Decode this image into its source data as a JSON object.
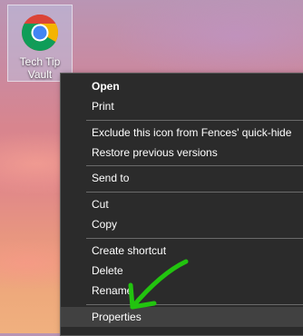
{
  "desktop_icon": {
    "label": "Tech Tip Vault",
    "icon": "chrome-logo-icon"
  },
  "context_menu": {
    "items": [
      {
        "label": "Open",
        "bold": true
      },
      {
        "label": "Print"
      },
      {
        "label": "Exclude this icon from Fences' quick-hide"
      },
      {
        "label": "Restore previous versions"
      },
      {
        "label": "Send to"
      },
      {
        "label": "Cut"
      },
      {
        "label": "Copy"
      },
      {
        "label": "Create shortcut"
      },
      {
        "label": "Delete"
      },
      {
        "label": "Rename"
      },
      {
        "label": "Properties",
        "highlighted": true
      }
    ]
  },
  "annotation": {
    "icon": "green-arrow-icon",
    "color": "#22c40f"
  }
}
